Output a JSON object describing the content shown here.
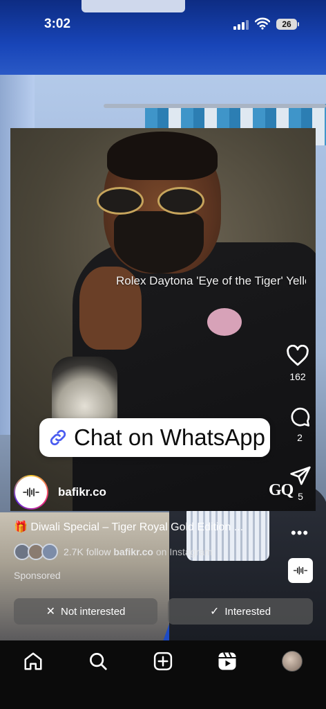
{
  "status_bar": {
    "time": "3:02",
    "battery": "26"
  },
  "post": {
    "ticker_text": "Rolex Daytona 'Eye of the Tiger' Yellow Gold Dial",
    "cta_label": "Chat on WhatsApp",
    "brand_name": "bafikr.co",
    "logo_text": "GQ",
    "caption": "🎁 Diwali Special – Tiger Royal Gold Edition ...",
    "follow_text": "2.7K follow",
    "follow_account": "bafikr.co",
    "follow_suffix": "on Instagram",
    "sponsored_label": "Sponsored"
  },
  "actions": {
    "likes": "162",
    "comments": "2",
    "shares": "5"
  },
  "buttons": {
    "not_interested": "Not interested",
    "interested": "Interested"
  },
  "nav": {
    "items": [
      "home-icon",
      "search-icon",
      "create-icon",
      "reels-icon",
      "profile-avatar"
    ]
  }
}
